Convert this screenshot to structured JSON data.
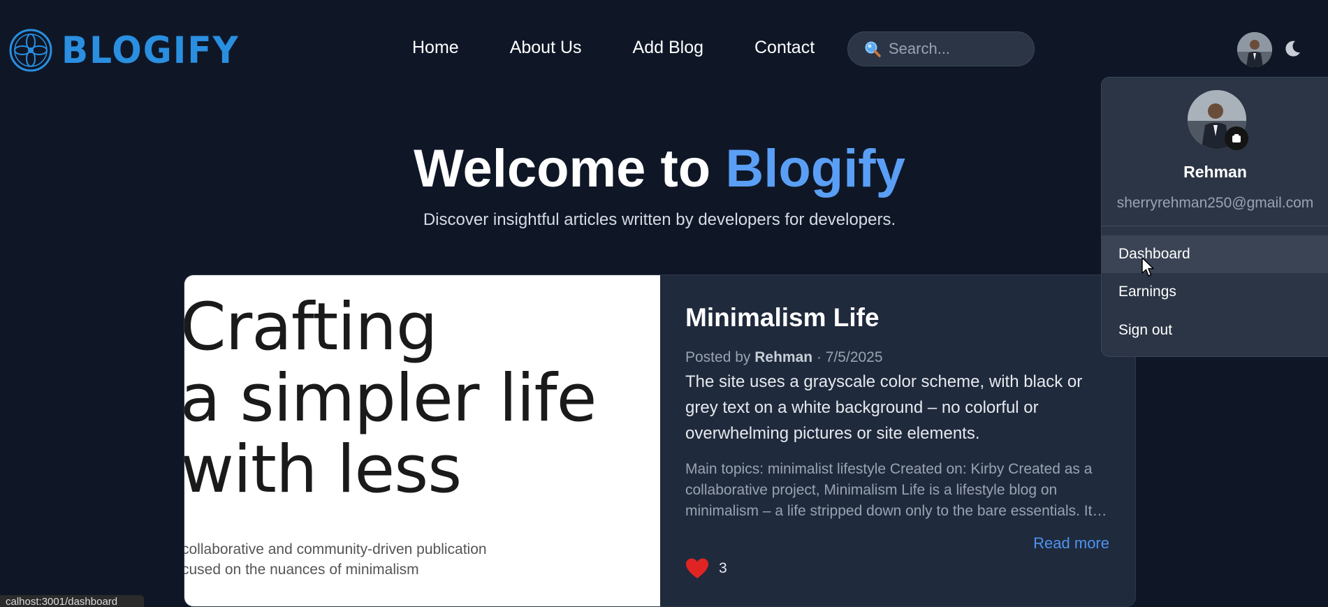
{
  "brand": {
    "name": "BLOGIFY",
    "accent": "#2a8fe0",
    "logo_icon": "flower-emblem-icon"
  },
  "nav": {
    "items": [
      "Home",
      "About Us",
      "Add Blog",
      "Contact"
    ]
  },
  "search": {
    "placeholder": "Search...",
    "value": "",
    "icon": "magnifier-icon"
  },
  "header": {
    "avatar_icon": "user-avatar",
    "theme_toggle_icon": "moon-icon"
  },
  "hero": {
    "title_prefix": "Welcome to ",
    "title_brand": "Blogify",
    "subtitle": "Discover insightful articles written by developers for developers."
  },
  "post": {
    "image_text_lines": [
      "Crafting",
      "a simpler life",
      "with less"
    ],
    "image_caption_lines": [
      "collaborative and community-driven publication",
      "cused on the nuances of minimalism"
    ],
    "title": "Minimalism Life",
    "posted_by_label": "Posted by",
    "author": "Rehman",
    "date": "7/5/2025",
    "lead": "The site uses a grayscale color scheme, with black or grey text on a white background – no colorful or overwhelming pictures or site elements.",
    "description": "Main topics: minimalist lifestyle Created on: Kirby Created as a collaborative project, Minimalism Life is a lifestyle blog on minimalism – a life stripped down only to the bare essentials. It…",
    "read_more": "Read more",
    "likes": "3",
    "like_color": "#e02424"
  },
  "user_menu": {
    "name": "Rehman",
    "email": "sherryrehman250@gmail.com",
    "items": [
      "Dashboard",
      "Earnings",
      "Sign out"
    ],
    "active_item": "Dashboard"
  },
  "status_bar": {
    "url": "calhost:3001/dashboard"
  }
}
